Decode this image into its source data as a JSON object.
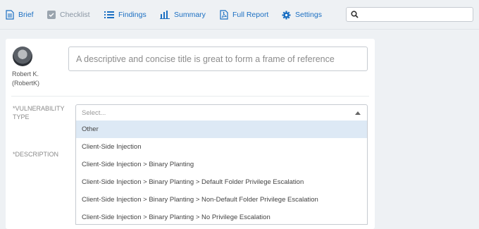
{
  "nav": {
    "items": [
      {
        "label": "Brief",
        "icon": "document-icon"
      },
      {
        "label": "Checklist",
        "icon": "checkbox-icon"
      },
      {
        "label": "Findings",
        "icon": "list-icon"
      },
      {
        "label": "Summary",
        "icon": "bar-chart-icon"
      },
      {
        "label": "Full Report",
        "icon": "pdf-icon"
      },
      {
        "label": "Settings",
        "icon": "gear-icon"
      }
    ],
    "search_value": ""
  },
  "user": {
    "name": "Robert K.",
    "handle": "(RobertK)"
  },
  "title_field": {
    "placeholder": "A descriptive and concise title is great to form a frame of reference"
  },
  "vulnerability": {
    "label_line1": "*VULNERABILITY",
    "label_line2": "TYPE",
    "selected": "Select...",
    "options": [
      "Other",
      "Client-Side Injection",
      "Client-Side Injection > Binary Planting",
      "Client-Side Injection > Binary Planting > Default Folder Privilege Escalation",
      "Client-Side Injection > Binary Planting > Non-Default Folder Privilege Escalation",
      "Client-Side Injection > Binary Planting > No Privilege Escalation"
    ]
  },
  "description": {
    "label": "*DESCRIPTION"
  },
  "colors": {
    "accent": "#1b6fc2",
    "disabled": "#8a96a3",
    "highlight": "#dde9f5"
  }
}
